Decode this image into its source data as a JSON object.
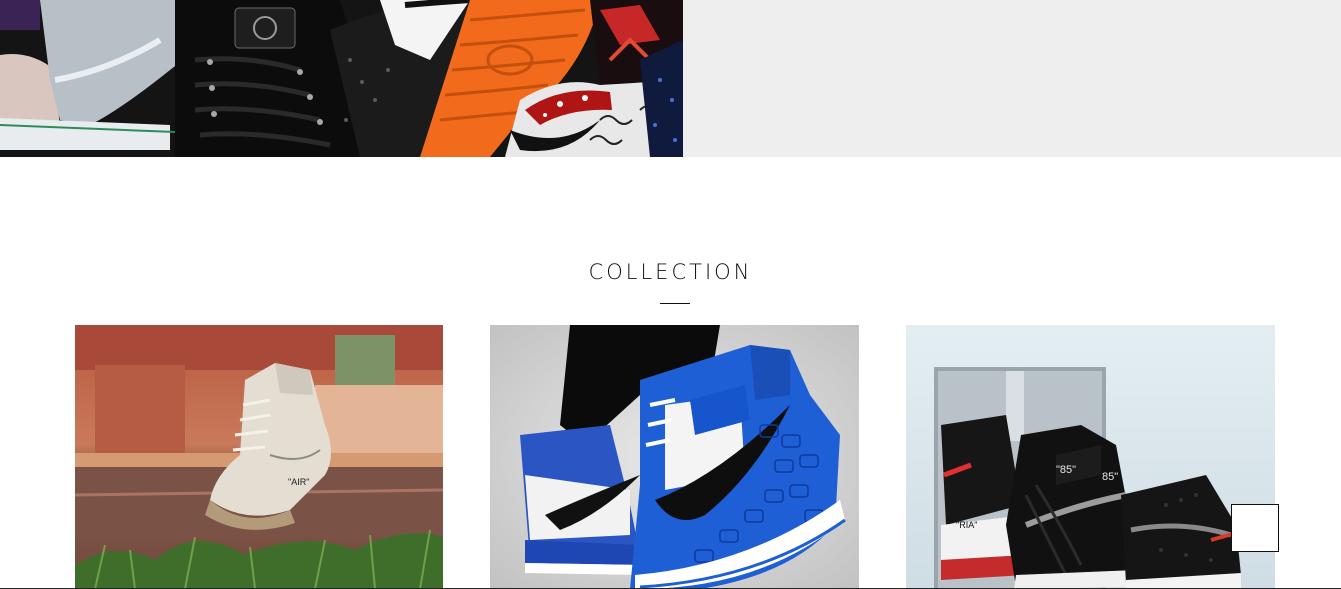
{
  "collection": {
    "title": "COLLECTION",
    "items": [
      {
        "image": "sneaker-offwhite-jordan-1-white-photo"
      },
      {
        "image": "sneaker-jordan-1-blue-croc-photo"
      },
      {
        "image": "sneaker-offwhite-jordan-1-black-mirror-photo"
      }
    ]
  },
  "hero": {
    "image": "sneaker-pile-photo"
  },
  "back_to_top": {
    "label": "",
    "icon": "arrow-up-icon"
  },
  "colors": {
    "panel_background": "#eeeeee",
    "text": "#111111",
    "accent_orange": "#f26a1b",
    "accent_blue": "#1d5fd6"
  }
}
